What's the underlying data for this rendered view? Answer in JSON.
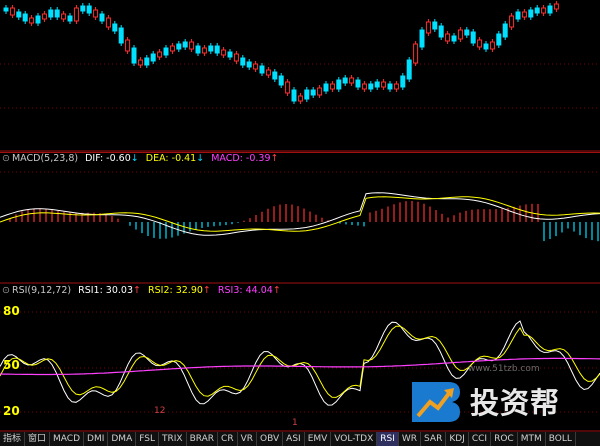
{
  "colors": {
    "up": "#ff3030",
    "down": "#00e0ff",
    "dif": "#ffffff",
    "dea": "#ffff00",
    "macd_up": "#ff3030",
    "macd_dn": "#00e0ff",
    "rsi1": "#ffffff",
    "rsi2": "#ffff00",
    "rsi3": "#ff40ff",
    "separator": "#a01010"
  },
  "macd_legend": {
    "name": "MACD(5,23,8)",
    "dif_label": "DIF: -0.60",
    "dif_arrow": "↓",
    "dea_label": "DEA: -0.41",
    "dea_arrow": "↓",
    "macd_label": "MACD: -0.39",
    "macd_arrow": "↑"
  },
  "rsi_legend": {
    "name": "RSI(9,12,72)",
    "rsi1_label": "RSI1: 30.03",
    "rsi1_arrow": "↑",
    "rsi2_label": "RSI2: 32.90",
    "rsi2_arrow": "↑",
    "rsi3_label": "RSI3: 44.04",
    "rsi3_arrow": "↑"
  },
  "rsi_axis": [
    "80",
    "50",
    "20"
  ],
  "x_tick": "12",
  "x_tick2": "1",
  "tabs": [
    "指标",
    "窗口",
    "MACD",
    "DMI",
    "DMA",
    "FSL",
    "TRIX",
    "BRAR",
    "CR",
    "VR",
    "OBV",
    "ASI",
    "EMV",
    "VOL-TDX",
    "RSI",
    "WR",
    "SAR",
    "KDJ",
    "CCI",
    "ROC",
    "MTM",
    "BOLL"
  ],
  "active_tab": "RSI",
  "watermark": {
    "brand": "投资帮",
    "url": "www.51tzb.com"
  }
}
